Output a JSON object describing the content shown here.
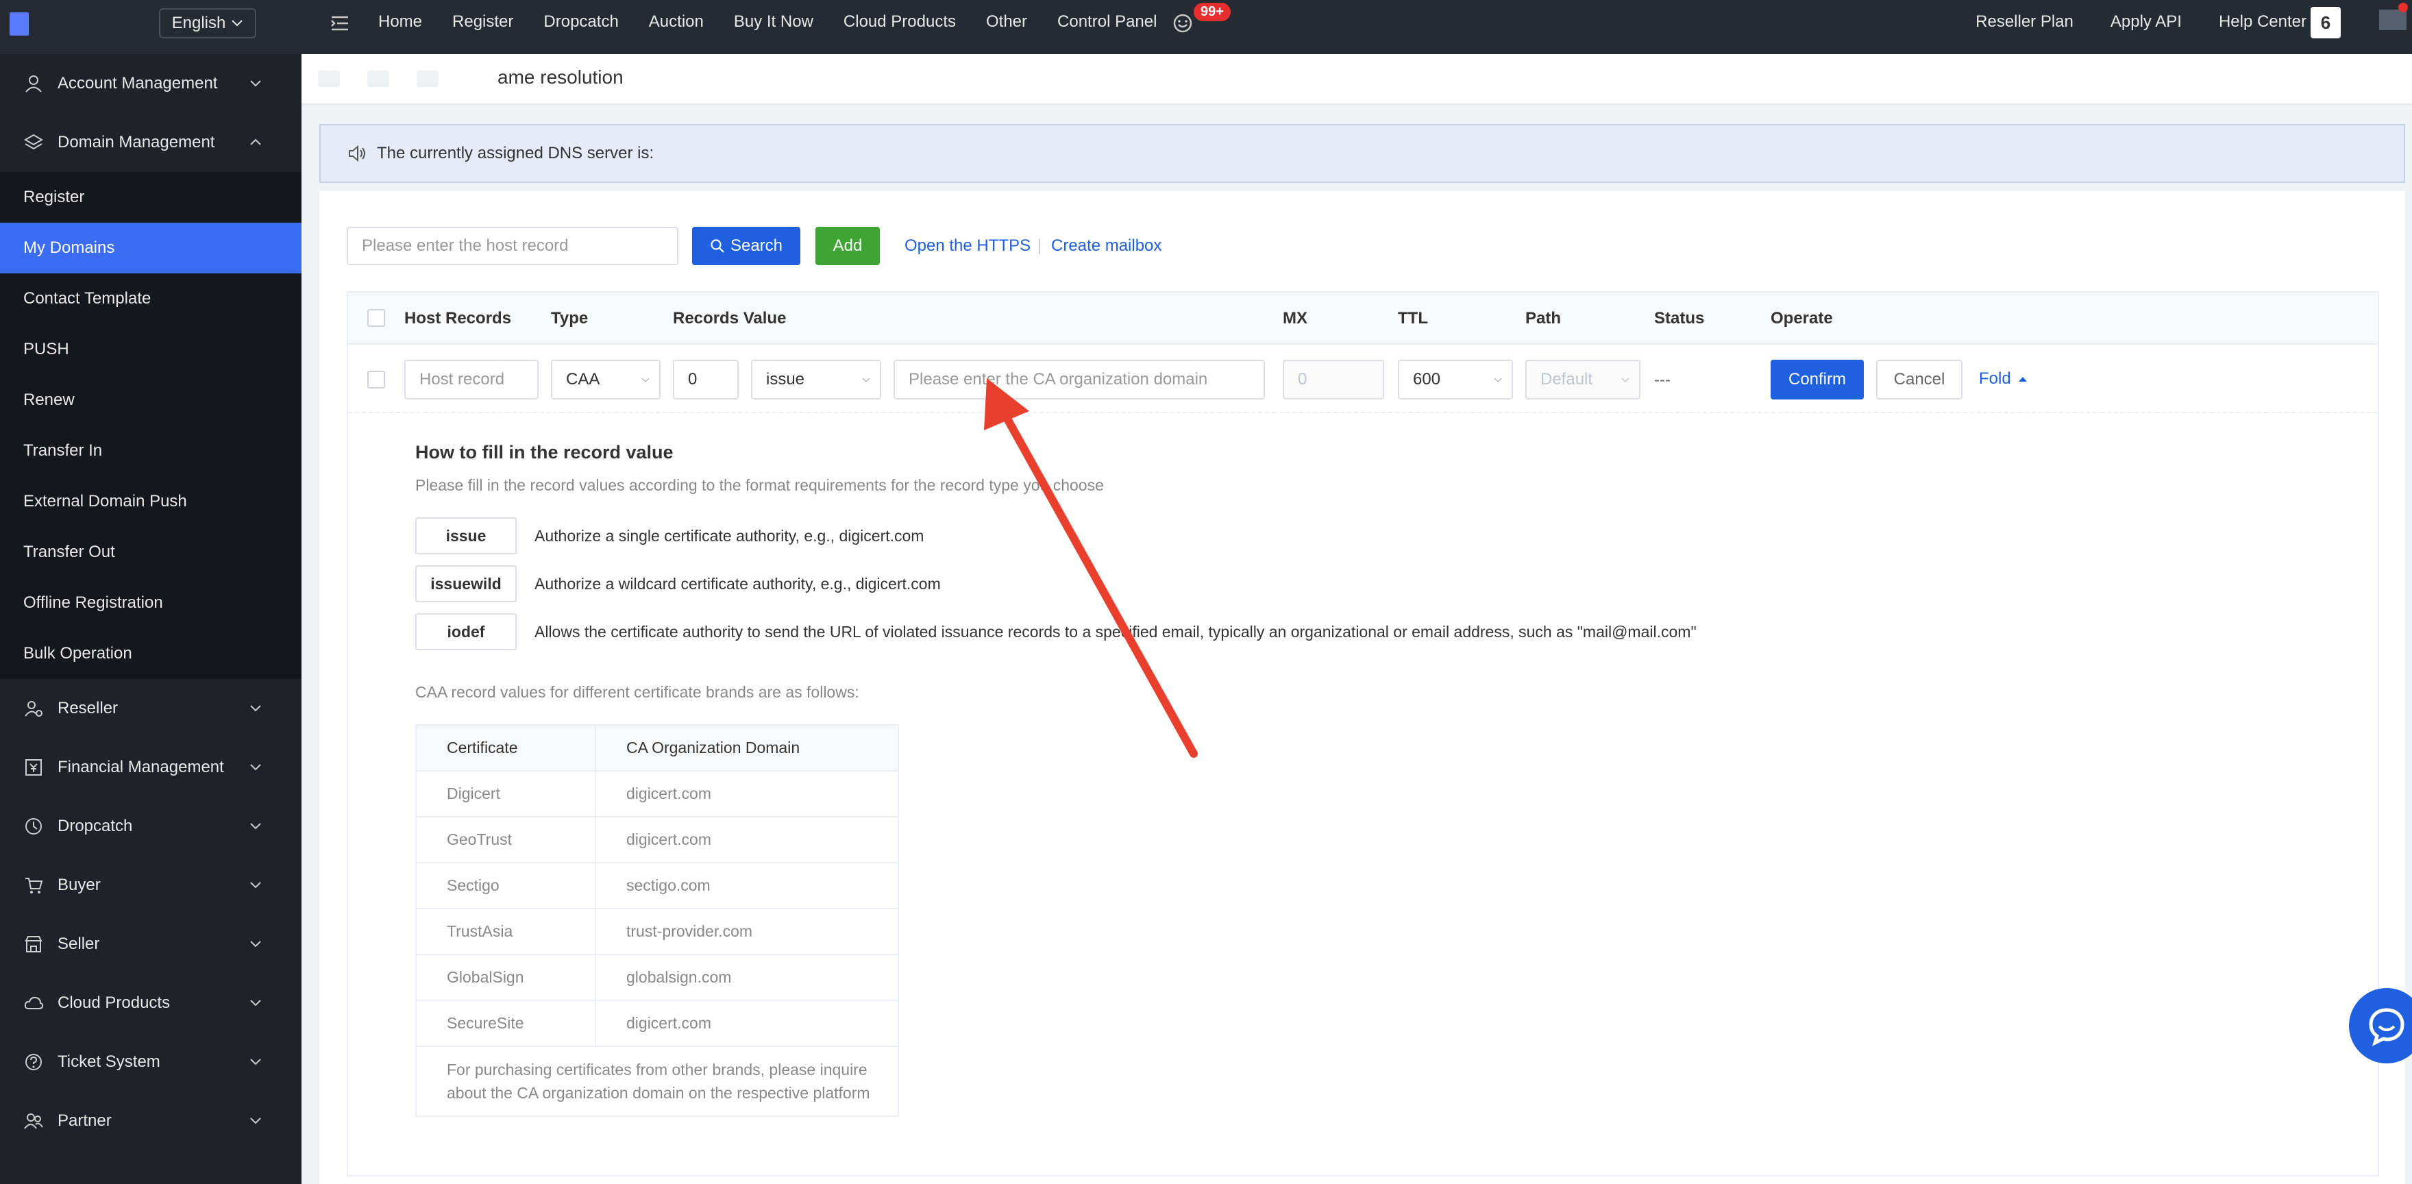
{
  "header": {
    "language": "English",
    "nav_left": [
      "Home",
      "Register",
      "Dropcatch",
      "Auction",
      "Buy It Now",
      "Cloud Products",
      "Other",
      "Control Panel"
    ],
    "notification_badge": "99+",
    "nav_right": [
      "Reseller Plan",
      "Apply API",
      "Help Center"
    ],
    "user_initial": "6"
  },
  "sidebar": {
    "groups_top": [
      {
        "label": "Account Management",
        "icon": "user-icon"
      },
      {
        "label": "Domain Management",
        "icon": "layers-icon"
      }
    ],
    "domain_items": [
      "Register",
      "My Domains",
      "Contact Template",
      "PUSH",
      "Renew",
      "Transfer In",
      "External Domain Push",
      "Transfer Out",
      "Offline Registration",
      "Bulk Operation"
    ],
    "active_item": "My Domains",
    "groups_bottom": [
      {
        "label": "Reseller",
        "icon": "reseller-icon"
      },
      {
        "label": "Financial Management",
        "icon": "finance-icon"
      },
      {
        "label": "Dropcatch",
        "icon": "clock-icon"
      },
      {
        "label": "Buyer",
        "icon": "cart-icon"
      },
      {
        "label": "Seller",
        "icon": "store-icon"
      },
      {
        "label": "Cloud Products",
        "icon": "cloud-icon"
      },
      {
        "label": "Ticket System",
        "icon": "help-circle-icon"
      },
      {
        "label": "Partner",
        "icon": "partner-icon"
      }
    ]
  },
  "page": {
    "title": "ame resolution",
    "dns_banner": "The currently assigned DNS server is:",
    "search_placeholder": "Please enter the host record",
    "search_button": "Search",
    "add_button": "Add",
    "link_https": "Open the HTTPS",
    "link_separator": "|",
    "link_mailbox": "Create mailbox"
  },
  "table": {
    "headers": [
      "Host Records",
      "Type",
      "Records Value",
      "MX",
      "TTL",
      "Path",
      "Status",
      "Operate"
    ],
    "edit_row": {
      "host_placeholder": "Host record",
      "type": "CAA",
      "flag": "0",
      "tag": "issue",
      "value_placeholder": "Please enter the CA organization domain",
      "mx_placeholder": "0",
      "ttl": "600",
      "path_placeholder": "Default",
      "status": "---",
      "confirm": "Confirm",
      "cancel": "Cancel",
      "fold": "Fold"
    }
  },
  "help": {
    "title": "How to fill in the record value",
    "subtitle": "Please fill in the record values according to the format requirements for the record type you choose",
    "options": [
      {
        "tag": "issue",
        "desc": "Authorize a single certificate authority, e.g., digicert.com"
      },
      {
        "tag": "issuewild",
        "desc": "Authorize a wildcard certificate authority, e.g., digicert.com"
      },
      {
        "tag": "iodef",
        "desc": "Allows the certificate authority to send the URL of violated issuance records to a specified email, typically an organizational or email address, such as \"mail@mail.com\""
      }
    ],
    "brands_label": "CAA record values for different certificate brands are as follows:",
    "brand_headers": [
      "Certificate",
      "CA Organization Domain"
    ],
    "brands": [
      {
        "name": "Digicert",
        "domain": "digicert.com"
      },
      {
        "name": "GeoTrust",
        "domain": "digicert.com"
      },
      {
        "name": "Sectigo",
        "domain": "sectigo.com"
      },
      {
        "name": "TrustAsia",
        "domain": "trust-provider.com"
      },
      {
        "name": "GlobalSign",
        "domain": "globalsign.com"
      },
      {
        "name": "SecureSite",
        "domain": "digicert.com"
      }
    ],
    "note": "For purchasing certificates from other brands, please inquire about the CA organization domain on the respective platform"
  },
  "colors": {
    "primary": "#1f60e0",
    "success": "#3ea534",
    "sidebar_bg": "#1f2229",
    "topbar_bg": "#252a33",
    "active_item": "#3b6cf6",
    "annotation_arrow": "#e8402c"
  }
}
